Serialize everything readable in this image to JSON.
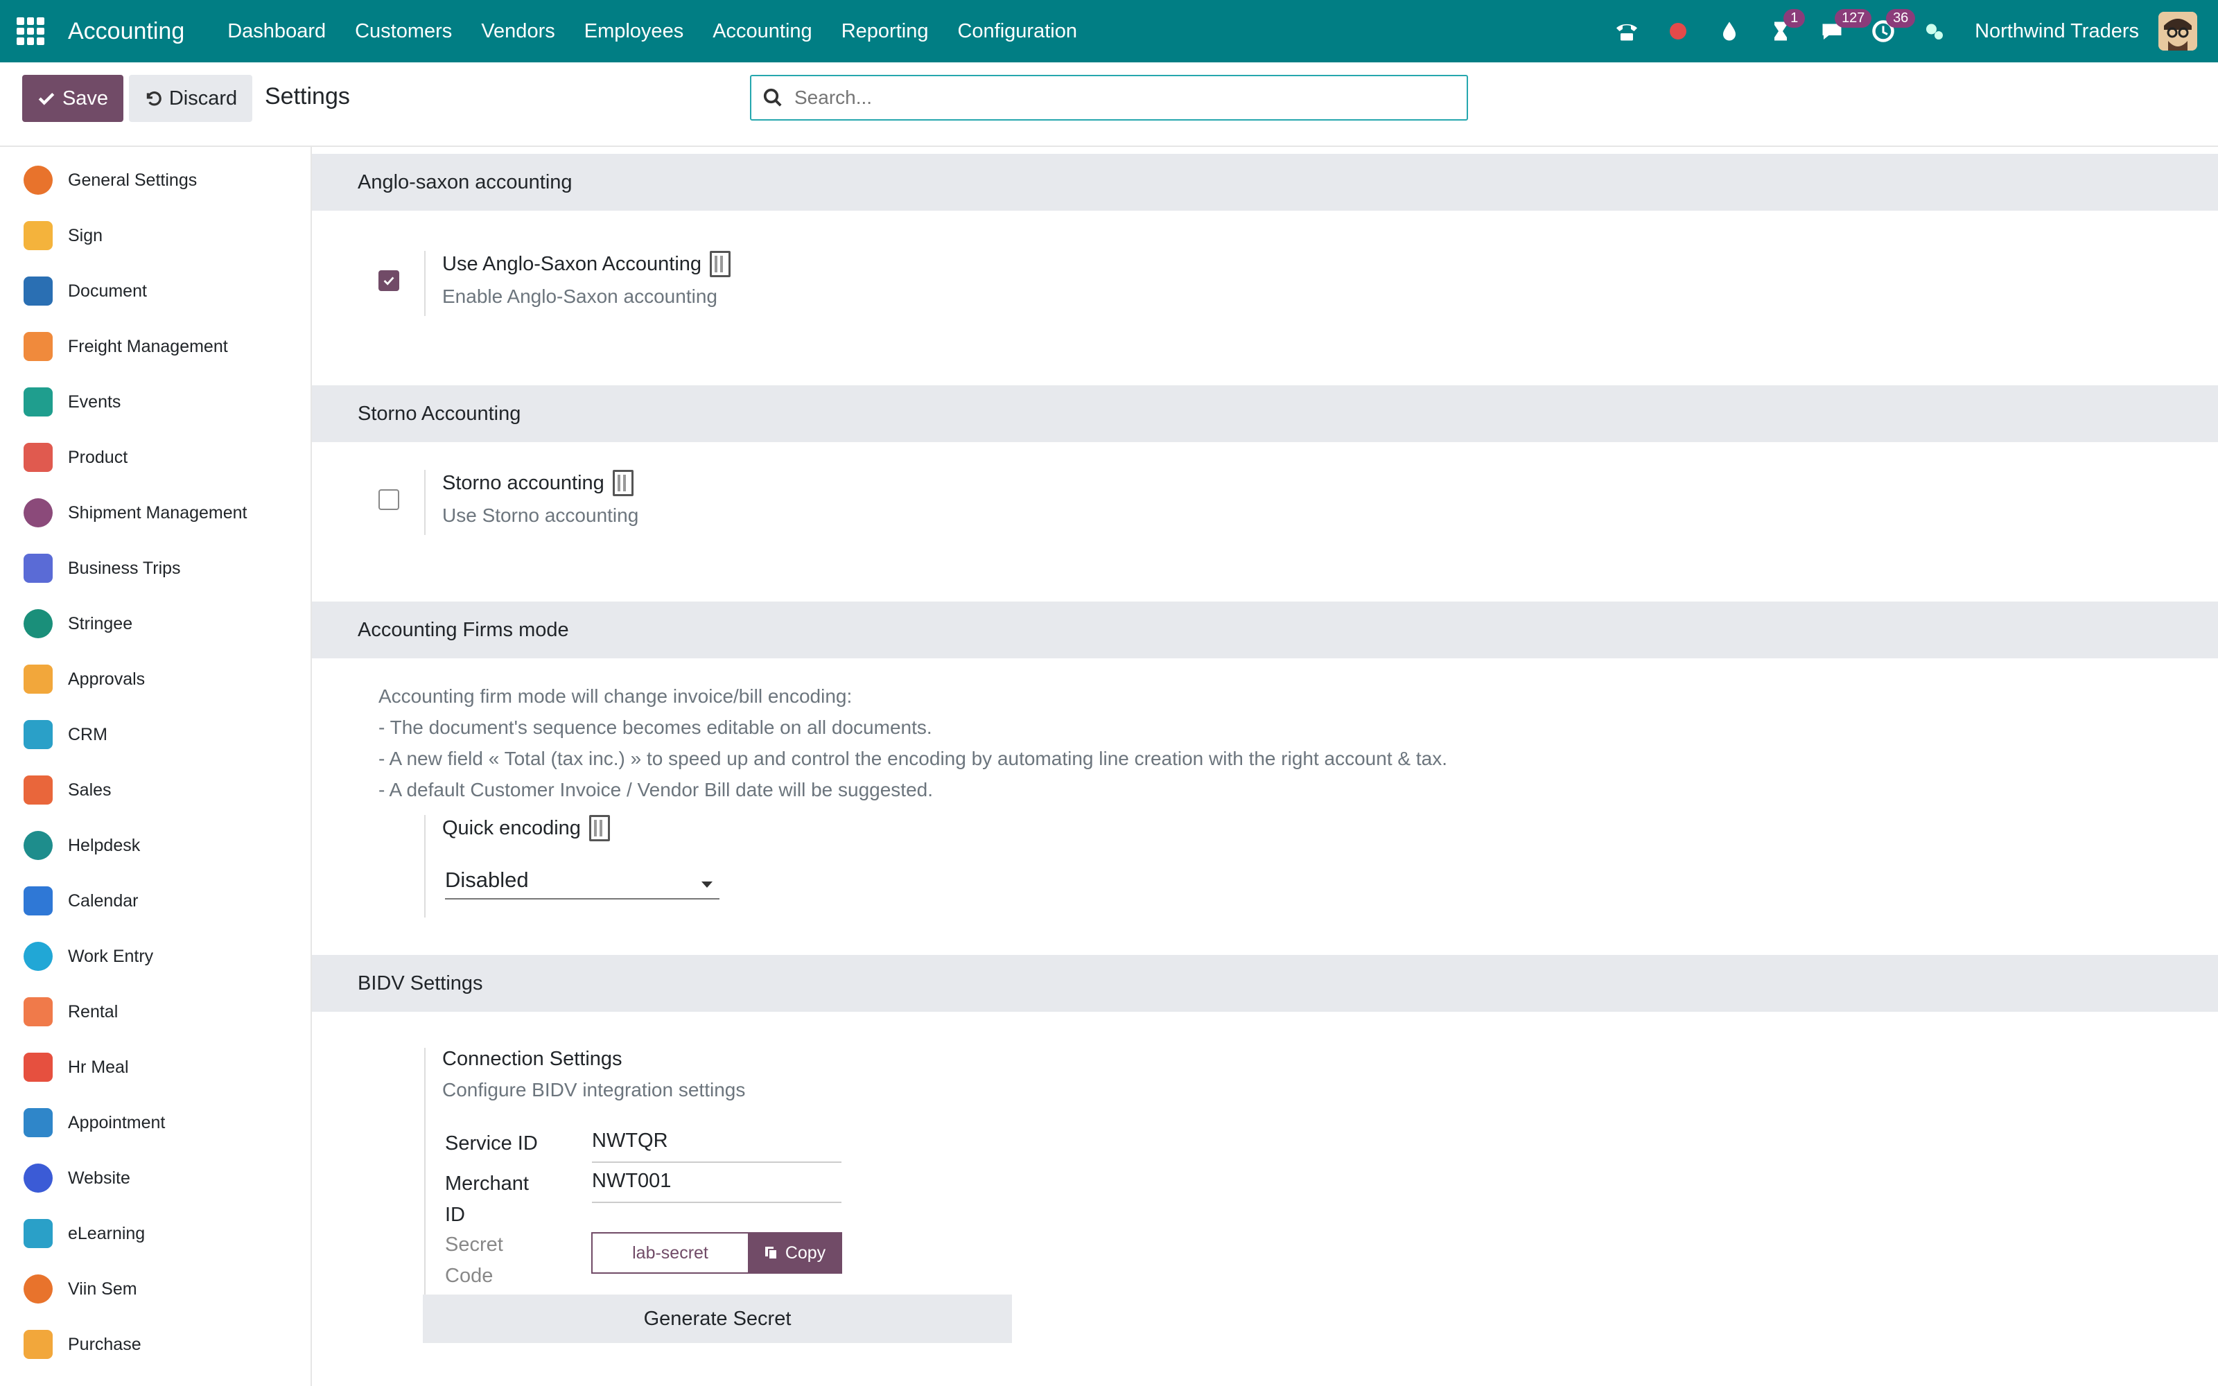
{
  "navbar": {
    "app_name": "Accounting",
    "menu": [
      "Dashboard",
      "Customers",
      "Vendors",
      "Employees",
      "Accounting",
      "Reporting",
      "Configuration"
    ],
    "badges": {
      "activities": "1",
      "messages": "127",
      "updates": "36"
    },
    "company": "Northwind Traders"
  },
  "control": {
    "save_label": "Save",
    "discard_label": "Discard",
    "title": "Settings",
    "search_placeholder": "Search..."
  },
  "sidebar": {
    "items": [
      {
        "label": "General Settings",
        "icon": "general-settings-icon",
        "color": "#e8732c"
      },
      {
        "label": "Sign",
        "icon": "sign-icon",
        "color": "#f4b33c"
      },
      {
        "label": "Document",
        "icon": "document-icon",
        "color": "#2a6fb3"
      },
      {
        "label": "Freight Management",
        "icon": "freight-icon",
        "color": "#f08a3c"
      },
      {
        "label": "Events",
        "icon": "events-icon",
        "color": "#1f9e8e"
      },
      {
        "label": "Product",
        "icon": "product-icon",
        "color": "#e05a4f"
      },
      {
        "label": "Shipment Management",
        "icon": "shipment-icon",
        "color": "#8b4a7a"
      },
      {
        "label": "Business Trips",
        "icon": "business-trips-icon",
        "color": "#5a6bd6"
      },
      {
        "label": "Stringee",
        "icon": "stringee-icon",
        "color": "#1a8f7a"
      },
      {
        "label": "Approvals",
        "icon": "approvals-icon",
        "color": "#f2a73b"
      },
      {
        "label": "CRM",
        "icon": "crm-icon",
        "color": "#2aa0c8"
      },
      {
        "label": "Sales",
        "icon": "sales-icon",
        "color": "#e9663b"
      },
      {
        "label": "Helpdesk",
        "icon": "helpdesk-icon",
        "color": "#1e8d8c"
      },
      {
        "label": "Calendar",
        "icon": "calendar-icon",
        "color": "#2f78d6"
      },
      {
        "label": "Work Entry",
        "icon": "work-entry-icon",
        "color": "#21a7d6"
      },
      {
        "label": "Rental",
        "icon": "rental-icon",
        "color": "#f07a4a"
      },
      {
        "label": "Hr Meal",
        "icon": "hr-meal-icon",
        "color": "#e6503f"
      },
      {
        "label": "Appointment",
        "icon": "appointment-icon",
        "color": "#2f86c9"
      },
      {
        "label": "Website",
        "icon": "website-icon",
        "color": "#3b5bd6"
      },
      {
        "label": "eLearning",
        "icon": "elearning-icon",
        "color": "#2aa0c8"
      },
      {
        "label": "Viin Sem",
        "icon": "viin-sem-icon",
        "color": "#e8732c"
      },
      {
        "label": "Purchase",
        "icon": "purchase-icon",
        "color": "#f2a73b"
      }
    ]
  },
  "sections": {
    "anglo": {
      "header": "Anglo-saxon accounting",
      "title": "Use Anglo-Saxon Accounting",
      "desc": "Enable Anglo-Saxon accounting",
      "checked": true
    },
    "storno": {
      "header": "Storno Accounting",
      "title": "Storno accounting",
      "desc": "Use Storno accounting",
      "checked": false
    },
    "firms": {
      "header": "Accounting Firms mode",
      "lines": [
        "Accounting firm mode will change invoice/bill encoding:",
        "- The document's sequence becomes editable on all documents.",
        "- A new field « Total (tax inc.) » to speed up and control the encoding by automating line creation with the right account & tax.",
        "- A default Customer Invoice / Vendor Bill date will be suggested."
      ],
      "quick_title": "Quick encoding",
      "quick_value": "Disabled"
    },
    "bidv": {
      "header": "BIDV Settings",
      "title": "Connection Settings",
      "desc": "Configure BIDV integration settings",
      "service_label": "Service ID",
      "service_value": "NWTQR",
      "merchant_label_1": "Merchant",
      "merchant_label_2": "ID",
      "merchant_value": "NWT001",
      "secret_label_1": "Secret",
      "secret_label_2": "Code",
      "secret_value": "lab-secret",
      "copy_label": "Copy",
      "generate_label": "Generate Secret"
    }
  },
  "colors": {
    "navbar": "#017e84",
    "primary": "#714b67",
    "section_bg": "#e7e9ed"
  }
}
